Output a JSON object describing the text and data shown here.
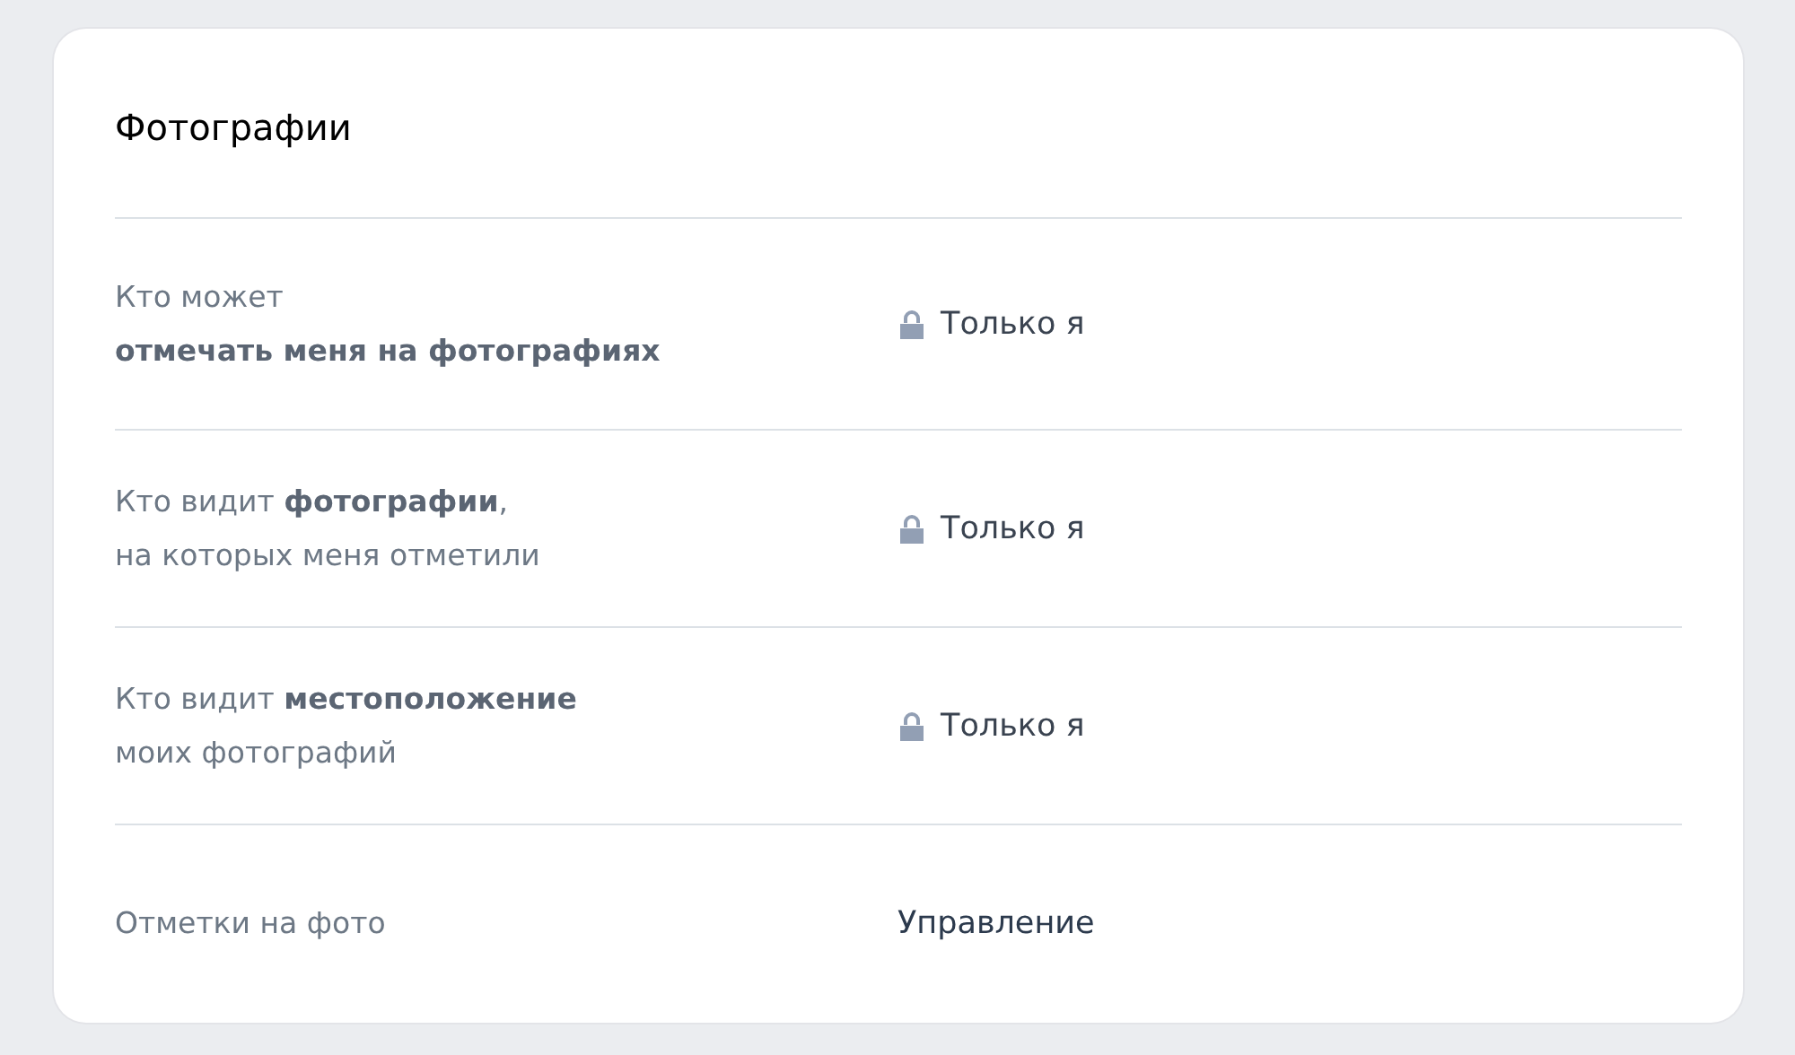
{
  "section": {
    "title": "Фотографии"
  },
  "rows": [
    {
      "label_lines": [
        "Кто может",
        "**отмечать меня на фотографиях**"
      ],
      "kind": "privacy",
      "value": "Только я"
    },
    {
      "label_lines": [
        "Кто видит **фотографии**,",
        "на которых меня отметили"
      ],
      "kind": "privacy",
      "value": "Только я"
    },
    {
      "label_lines": [
        "Кто видит **местоположение**",
        "моих фотографий"
      ],
      "kind": "privacy",
      "value": "Только я"
    },
    {
      "label_lines": [
        "Отметки на фото"
      ],
      "kind": "link",
      "value": "Управление"
    }
  ]
}
